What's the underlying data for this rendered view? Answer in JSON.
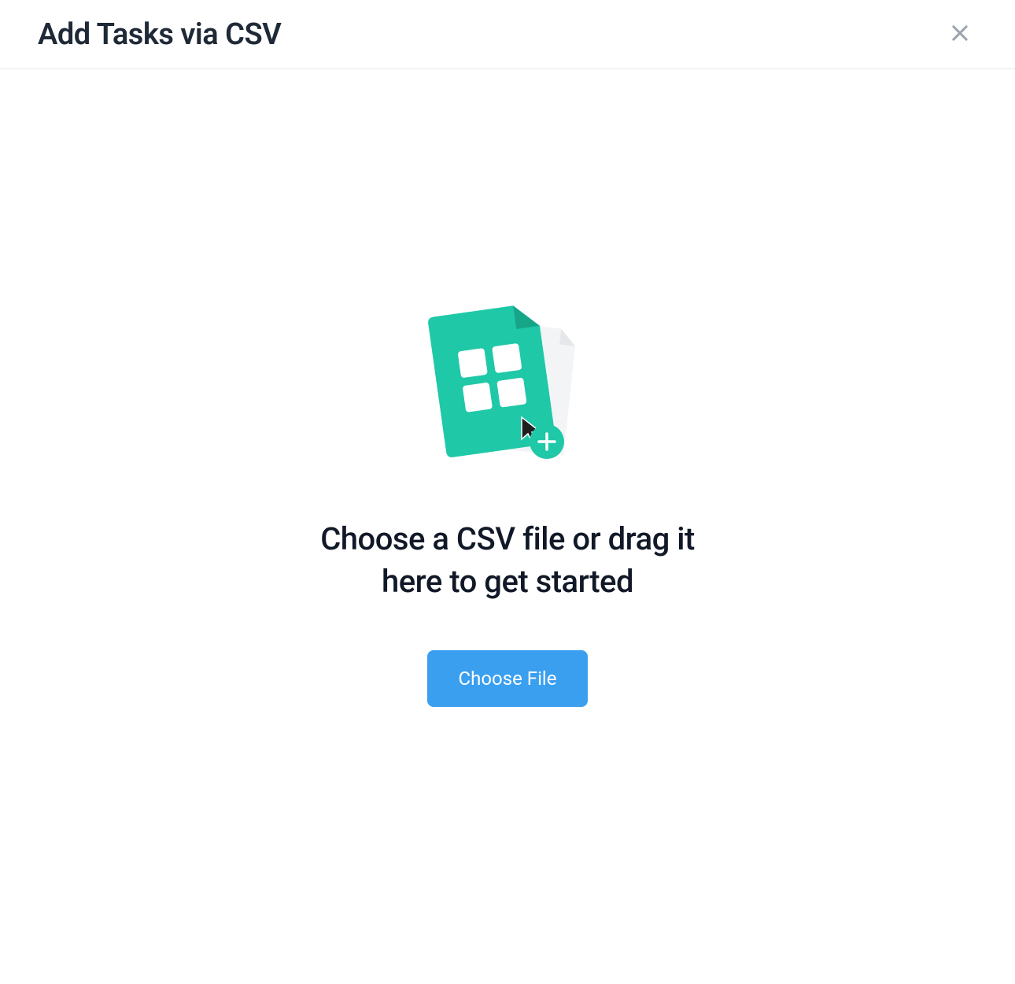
{
  "header": {
    "title": "Add Tasks via CSV"
  },
  "main": {
    "instruction": "Choose a CSV file or drag it here to get started",
    "choose_button_label": "Choose File"
  },
  "icons": {
    "close": "close-icon",
    "illustration": "csv-file-upload-icon"
  },
  "colors": {
    "accent_teal": "#1fc8a7",
    "button_blue": "#3b9ff0",
    "text_dark": "#1f2937",
    "muted_gray": "#9ca3af"
  }
}
